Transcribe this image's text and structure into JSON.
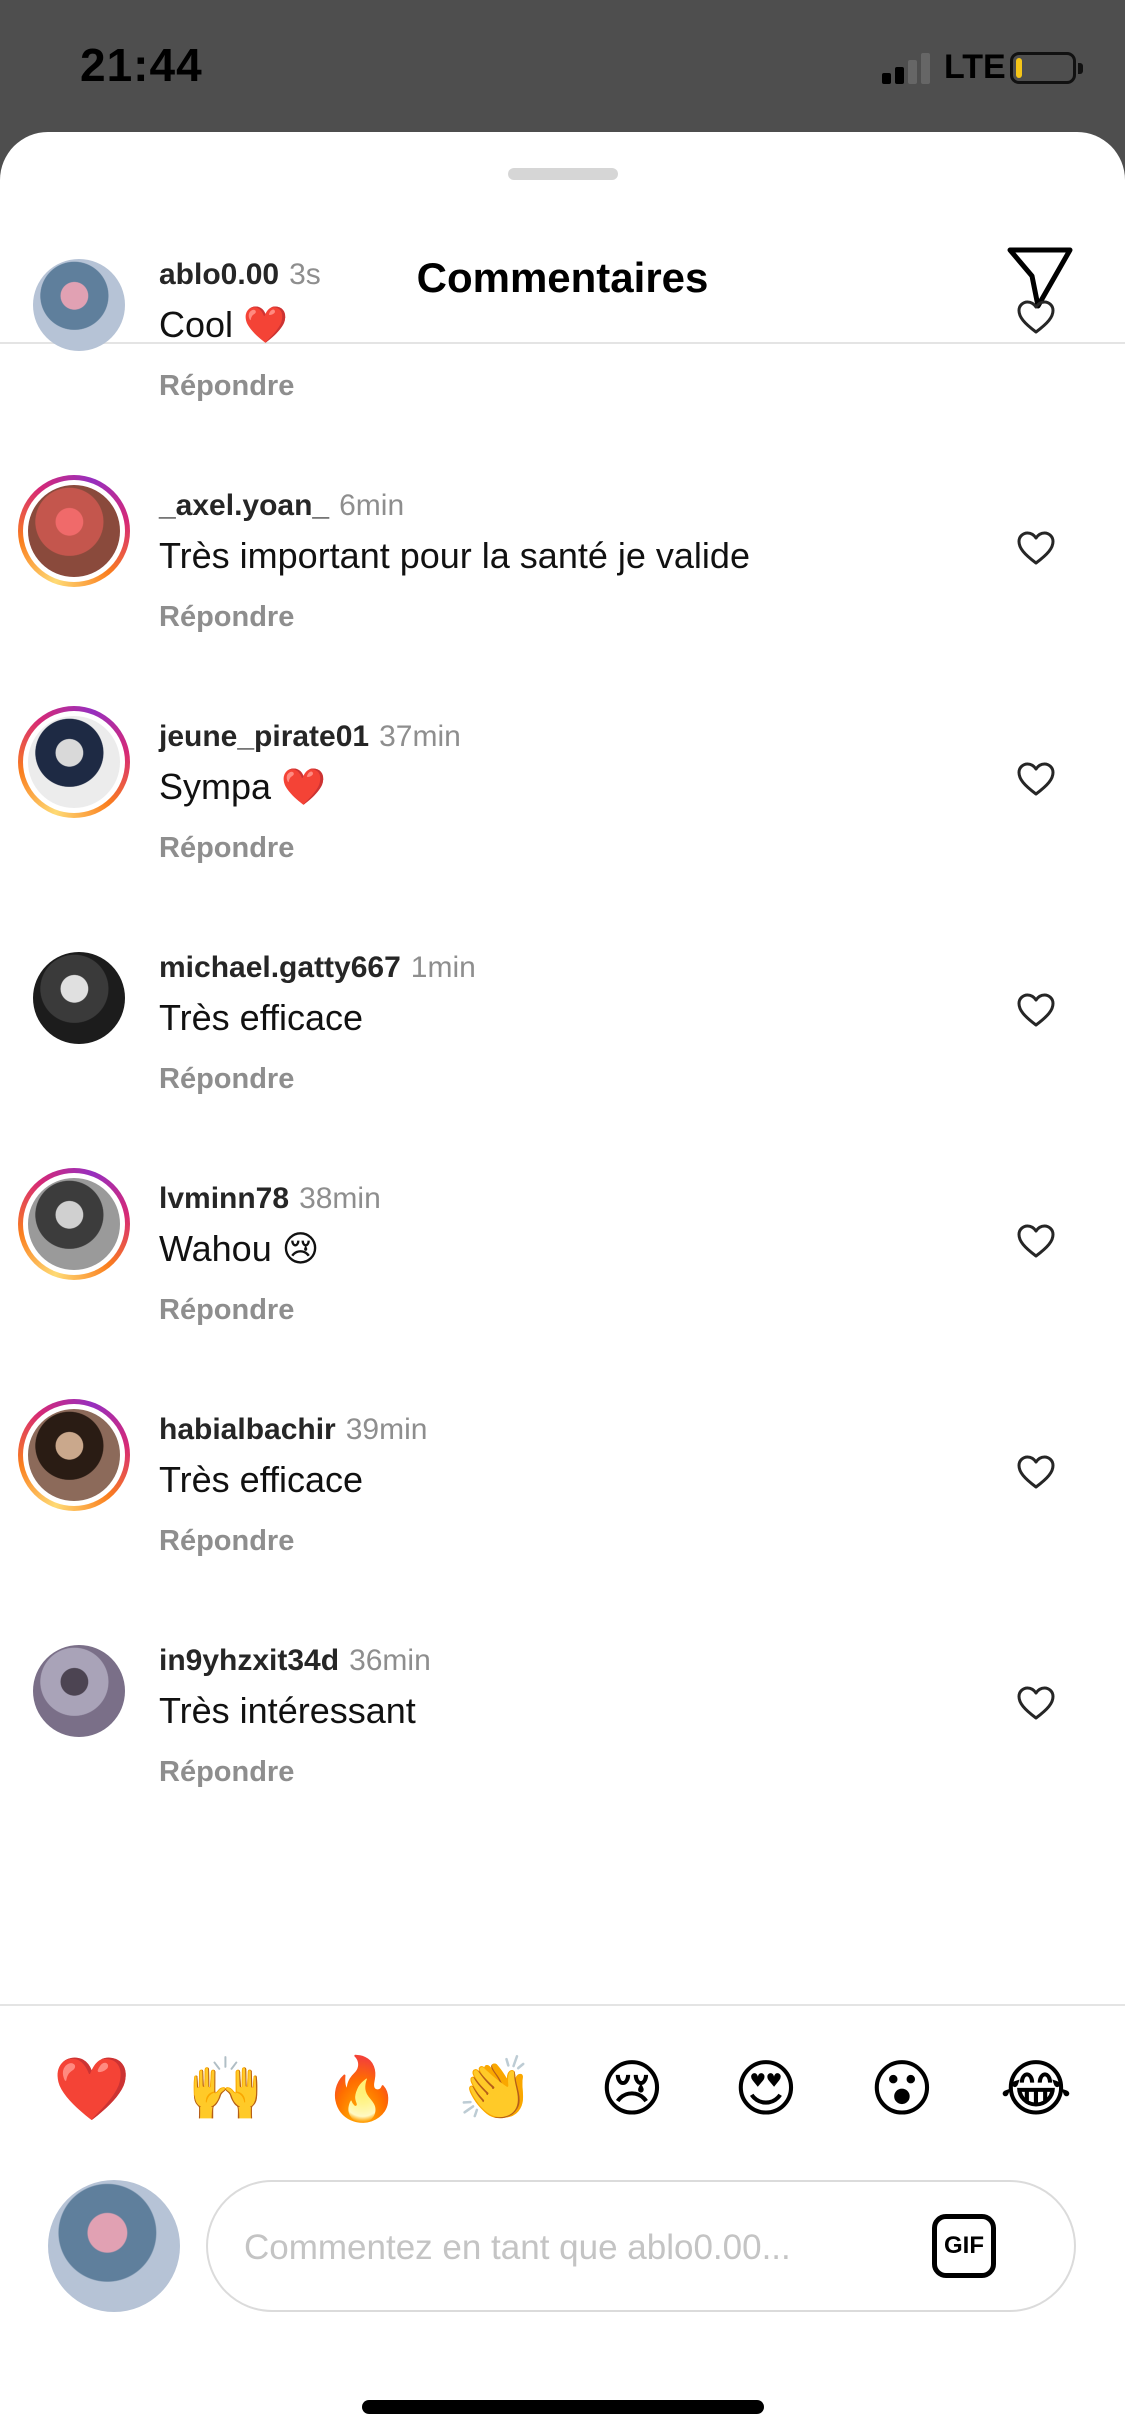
{
  "status_bar": {
    "time": "21:44",
    "network": "LTE",
    "battery_level": 0.1,
    "battery_color": "#f5c518"
  },
  "header": {
    "title": "Commentaires",
    "share_icon": "paper-plane-icon"
  },
  "comments": [
    {
      "username": "ablo0.00",
      "time": "3s",
      "text": "Cool ❤️",
      "reply": "Répondre",
      "story_ring": false,
      "avatar_colors": [
        "#b6c3d6",
        "#5f7f9c",
        "#e1a1b3"
      ]
    },
    {
      "username": "_axel.yoan_",
      "time": "6min",
      "text": "Très important pour la santé je valide",
      "reply": "Répondre",
      "story_ring": true,
      "avatar_colors": [
        "#8a4a3c",
        "#c4564d",
        "#f06a6a"
      ]
    },
    {
      "username": "jeune_pirate01",
      "time": "37min",
      "text": "Sympa ❤️",
      "reply": "Répondre",
      "story_ring": true,
      "avatar_colors": [
        "#ececec",
        "#1e2a44",
        "#d9d9d9"
      ]
    },
    {
      "username": "michael.gatty667",
      "time": "1min",
      "text": "Très efficace",
      "reply": "Répondre",
      "story_ring": false,
      "avatar_colors": [
        "#1c1c1c",
        "#3a3a3a",
        "#e0e0e0"
      ]
    },
    {
      "username": "lvminn78",
      "time": "38min",
      "text": "Wahou 😢",
      "reply": "Répondre",
      "story_ring": true,
      "avatar_colors": [
        "#9a9a9a",
        "#3c3c3c",
        "#d0d0d0"
      ]
    },
    {
      "username": "habialbachir",
      "time": "39min",
      "text": "Très efficace",
      "reply": "Répondre",
      "story_ring": true,
      "avatar_colors": [
        "#8c6a5a",
        "#2a1c14",
        "#caa88c"
      ]
    },
    {
      "username": "in9yhzxit34d",
      "time": "36min",
      "text": "Très intéressant",
      "reply": "Répondre",
      "story_ring": false,
      "avatar_colors": [
        "#7a6f88",
        "#a9a3b8",
        "#4c4452"
      ]
    }
  ],
  "quick_reactions": [
    "❤️",
    "🙌",
    "🔥",
    "👏",
    "😢",
    "😍",
    "😮",
    "😂"
  ],
  "composer": {
    "placeholder": "Commentez en tant que ablo0.00...",
    "value": "",
    "gif_label": "GIF",
    "avatar_colors": [
      "#b6c3d6",
      "#5f7f9c",
      "#e1a1b3"
    ]
  },
  "colors": {
    "username": "#262626",
    "secondary": "#8e8e8e",
    "divider": "#e4e4e4"
  }
}
